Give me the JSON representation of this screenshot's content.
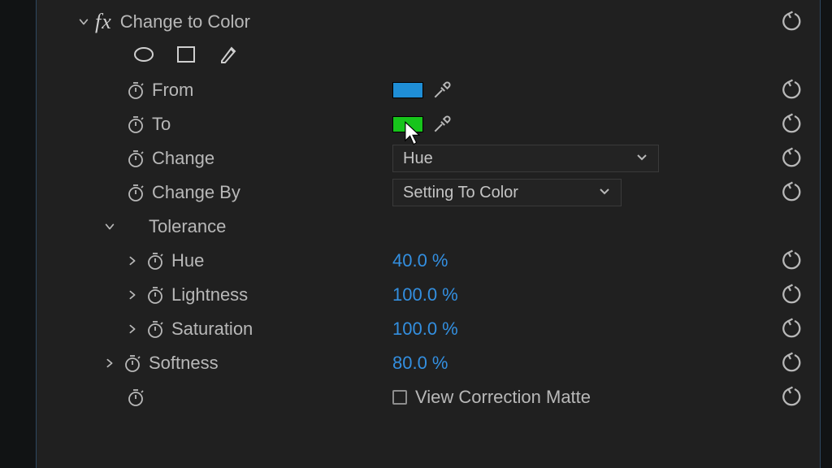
{
  "effect": {
    "title": "Change to Color",
    "from": {
      "label": "From",
      "color": "#1f8ed6"
    },
    "to": {
      "label": "To",
      "color": "#17c41b"
    },
    "change": {
      "label": "Change",
      "selected": "Hue"
    },
    "change_by": {
      "label": "Change By",
      "selected": "Setting To Color"
    },
    "tolerance": {
      "label": "Tolerance",
      "hue": {
        "label": "Hue",
        "value": "40.0 %"
      },
      "lightness": {
        "label": "Lightness",
        "value": "100.0 %"
      },
      "saturation": {
        "label": "Saturation",
        "value": "100.0 %"
      }
    },
    "softness": {
      "label": "Softness",
      "value": "80.0 %"
    },
    "view_matte": {
      "label": "View Correction Matte",
      "checked": false
    }
  }
}
